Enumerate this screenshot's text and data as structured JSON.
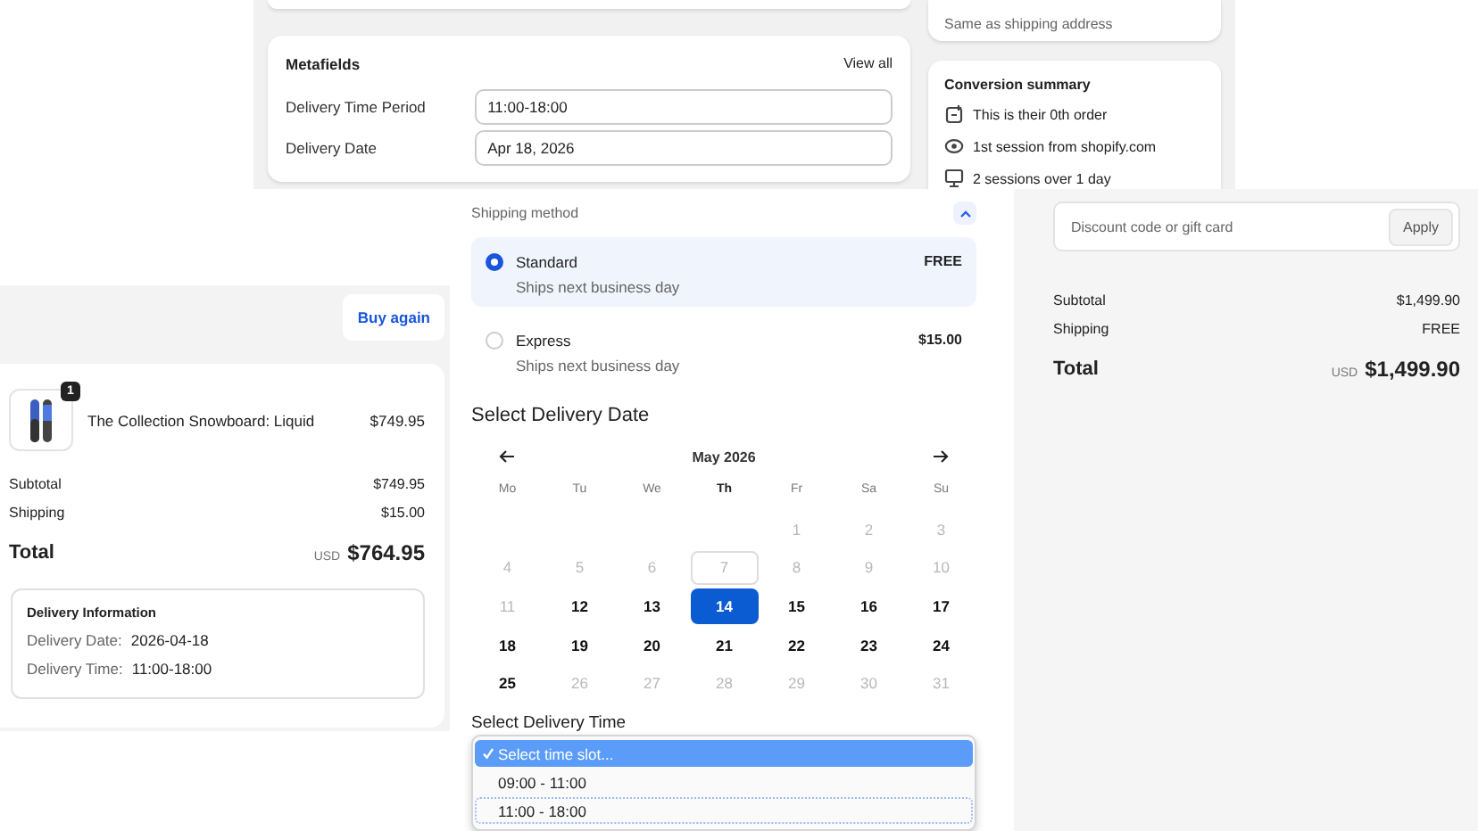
{
  "metafields": {
    "title": "Metafields",
    "link": "View all",
    "fields": [
      {
        "label": "Delivery Time Period",
        "value": "11:00-18:00"
      },
      {
        "label": "Delivery Date",
        "value": "Apr 18, 2026"
      }
    ]
  },
  "billing_address": {
    "value": "Same as shipping address"
  },
  "conversion_summary": {
    "title": "Conversion summary",
    "items": [
      {
        "kind": "order",
        "text": "This is their 0th order"
      },
      {
        "kind": "session",
        "text": "1st session from shopify.com"
      },
      {
        "kind": "visits",
        "text": "2 sessions over 1 day"
      }
    ]
  },
  "shipping_method": {
    "title": "Shipping method",
    "expanded": true,
    "options": [
      {
        "name": "Standard",
        "note": "Ships next business day",
        "price": "FREE",
        "selected": true
      },
      {
        "name": "Express",
        "note": "Ships next business day",
        "price": "$15.00",
        "selected": false
      }
    ]
  },
  "delivery_date": {
    "title": "Select Delivery Date",
    "month": "May 2026",
    "weekdays": [
      {
        "label": "Mo",
        "current": false
      },
      {
        "label": "Tu",
        "current": false
      },
      {
        "label": "We",
        "current": false
      },
      {
        "label": "Th",
        "current": true
      },
      {
        "label": "Fr",
        "current": false
      },
      {
        "label": "Sa",
        "current": false
      },
      {
        "label": "Su",
        "current": false
      }
    ],
    "weeks": [
      [
        {
          "label": "1",
          "available": false,
          "today": false,
          "selected": false
        },
        {
          "label": "2",
          "available": false,
          "today": false,
          "selected": false
        },
        {
          "label": "3",
          "available": false,
          "today": false,
          "selected": false
        }
      ],
      [
        {
          "label": "4",
          "available": false,
          "today": false,
          "selected": false
        },
        {
          "label": "5",
          "available": false,
          "today": false,
          "selected": false
        },
        {
          "label": "6",
          "available": false,
          "today": false,
          "selected": false
        },
        {
          "label": "7",
          "available": false,
          "today": true,
          "selected": false
        },
        {
          "label": "8",
          "available": false,
          "today": false,
          "selected": false
        },
        {
          "label": "9",
          "available": false,
          "today": false,
          "selected": false
        },
        {
          "label": "10",
          "available": false,
          "today": false,
          "selected": false
        }
      ],
      [
        {
          "label": "11",
          "available": false,
          "today": false,
          "selected": false
        },
        {
          "label": "12",
          "available": true,
          "today": false,
          "selected": false
        },
        {
          "label": "13",
          "available": true,
          "today": false,
          "selected": false
        },
        {
          "label": "14",
          "available": true,
          "today": false,
          "selected": true
        },
        {
          "label": "15",
          "available": true,
          "today": false,
          "selected": false
        },
        {
          "label": "16",
          "available": true,
          "today": false,
          "selected": false
        },
        {
          "label": "17",
          "available": true,
          "today": false,
          "selected": false
        }
      ],
      [
        {
          "label": "18",
          "available": true,
          "today": false,
          "selected": false
        },
        {
          "label": "19",
          "available": true,
          "today": false,
          "selected": false
        },
        {
          "label": "20",
          "available": true,
          "today": false,
          "selected": false
        },
        {
          "label": "21",
          "available": true,
          "today": false,
          "selected": false
        },
        {
          "label": "22",
          "available": true,
          "today": false,
          "selected": false
        },
        {
          "label": "23",
          "available": true,
          "today": false,
          "selected": false
        },
        {
          "label": "24",
          "available": true,
          "today": false,
          "selected": false
        }
      ],
      [
        {
          "label": "25",
          "available": true,
          "today": false,
          "selected": false
        },
        {
          "label": "26",
          "available": false,
          "today": false,
          "selected": false
        },
        {
          "label": "27",
          "available": false,
          "today": false,
          "selected": false
        },
        {
          "label": "28",
          "available": false,
          "today": false,
          "selected": false
        },
        {
          "label": "29",
          "available": false,
          "today": false,
          "selected": false
        },
        {
          "label": "30",
          "available": false,
          "today": false,
          "selected": false
        },
        {
          "label": "31",
          "available": false,
          "today": false,
          "selected": false
        }
      ]
    ]
  },
  "delivery_time": {
    "title": "Select Delivery Time",
    "options": [
      {
        "label": "Select time slot...",
        "selected": true,
        "focused": false
      },
      {
        "label": "09:00 - 11:00",
        "selected": false,
        "focused": false
      },
      {
        "label": "11:00 - 18:00",
        "selected": false,
        "focused": true
      }
    ]
  },
  "checkout_summary": {
    "discount": {
      "placeholder": "Discount code or gift card",
      "button": "Apply"
    },
    "subtotal": {
      "label": "Subtotal",
      "value": "$1,499.90"
    },
    "shipping": {
      "label": "Shipping",
      "value": "FREE"
    },
    "total": {
      "label": "Total",
      "currency": "USD",
      "value": "$1,499.90"
    }
  },
  "order_status": {
    "buy_again": "Buy again",
    "items": [
      {
        "name": "The Collection Snowboard: Liquid",
        "price": "$749.95",
        "quantity": "1"
      }
    ],
    "subtotal": {
      "label": "Subtotal",
      "value": "$749.95"
    },
    "shipping": {
      "label": "Shipping",
      "value": "$15.00"
    },
    "total": {
      "label": "Total",
      "currency": "USD",
      "value": "$764.95"
    },
    "delivery_info": {
      "title": "Delivery Information",
      "rows": [
        {
          "label": "Delivery Date:",
          "value": "2026-04-18"
        },
        {
          "label": "Delivery Time:",
          "value": "11:00-18:00"
        }
      ]
    }
  }
}
